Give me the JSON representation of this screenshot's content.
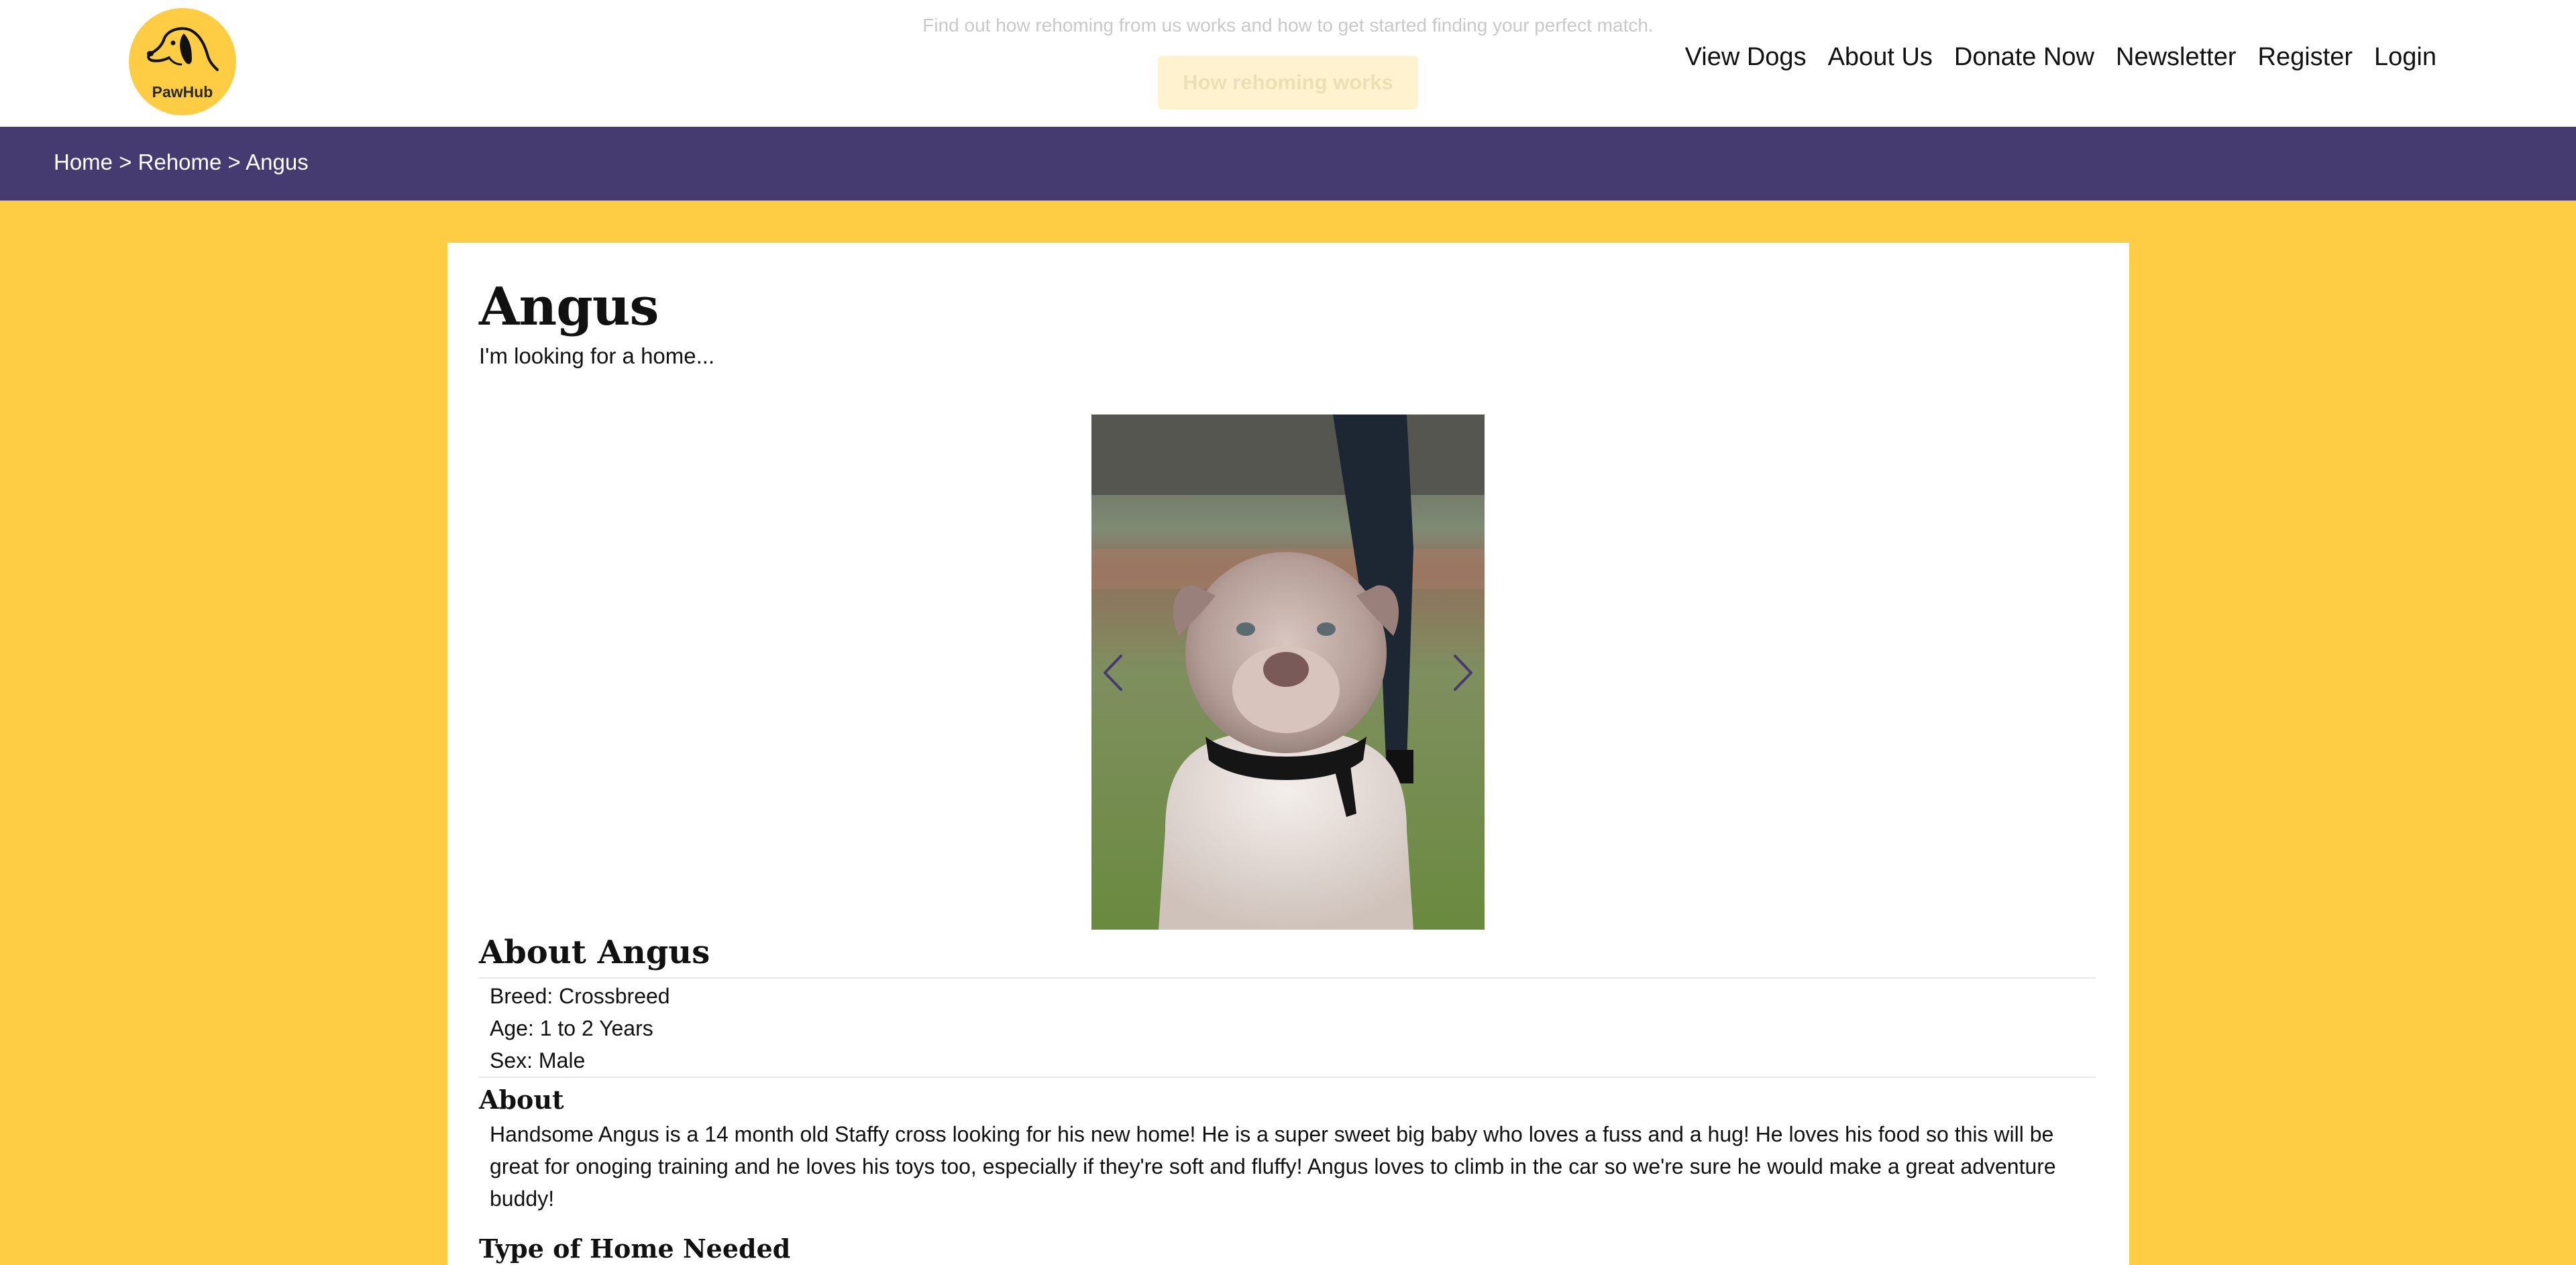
{
  "brand": {
    "name": "PawHub"
  },
  "hero": {
    "subtitle": "Find out how rehoming from us works and how to get started finding your perfect match.",
    "button_label": "How rehoming works"
  },
  "nav": {
    "items": [
      {
        "label": "View Dogs"
      },
      {
        "label": "About Us"
      },
      {
        "label": "Donate Now"
      },
      {
        "label": "Newsletter"
      },
      {
        "label": "Register"
      },
      {
        "label": "Login"
      }
    ]
  },
  "breadcrumb": {
    "items": [
      "Home",
      "Rehome",
      "Angus"
    ],
    "separator": " > "
  },
  "dog": {
    "name": "Angus",
    "tagline": "I'm looking for a home...",
    "about_heading": "About Angus",
    "facts": [
      "Breed: Crossbreed",
      "Age: 1 to 2 Years",
      "Sex: Male"
    ],
    "about_label": "About",
    "description": "Handsome Angus is a 14 month old Staffy cross looking for his new home! He is a super sweet big baby who loves a fuss and a hug! He loves his food so this will be great for onoging training and he loves his toys too, especially if they're soft and fluffy! Angus loves to climb in the car so we're sure he would make a great adventure buddy!",
    "home_needed_label": "Type of Home Needed"
  },
  "colors": {
    "page_background": "#ffcd44",
    "breadcrumb_bar": "#453b71",
    "carousel_arrow": "#453b71",
    "card": "#ffffff"
  }
}
